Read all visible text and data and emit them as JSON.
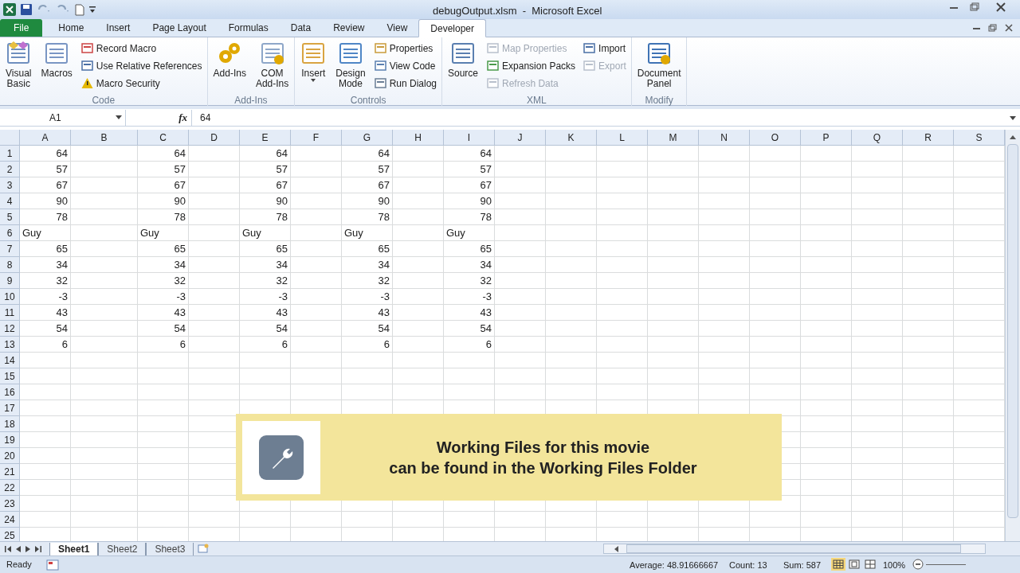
{
  "window": {
    "title": "debugOutput.xlsm  -  Microsoft Excel"
  },
  "tabs": [
    {
      "label": "File",
      "kind": "file",
      "selected": false
    },
    {
      "label": "Home",
      "kind": "tab",
      "selected": false
    },
    {
      "label": "Insert",
      "kind": "tab",
      "selected": false
    },
    {
      "label": "Page Layout",
      "kind": "tab",
      "selected": false
    },
    {
      "label": "Formulas",
      "kind": "tab",
      "selected": false
    },
    {
      "label": "Data",
      "kind": "tab",
      "selected": false
    },
    {
      "label": "Review",
      "kind": "tab",
      "selected": false
    },
    {
      "label": "View",
      "kind": "tab",
      "selected": false
    },
    {
      "label": "Developer",
      "kind": "tab",
      "selected": true
    }
  ],
  "ribbon_groups": [
    {
      "label": "Code",
      "items": [
        {
          "kind": "large",
          "label": "Visual\nBasic",
          "disabled": false
        },
        {
          "kind": "large",
          "label": "Macros",
          "disabled": false
        },
        {
          "kind": "small",
          "label": "Record Macro",
          "disabled": false
        },
        {
          "kind": "small",
          "label": "Use Relative References",
          "disabled": false
        },
        {
          "kind": "small",
          "label": "Macro Security",
          "disabled": false
        }
      ]
    },
    {
      "label": "Add-Ins",
      "items": [
        {
          "kind": "large",
          "label": "Add-Ins",
          "disabled": false
        },
        {
          "kind": "large",
          "label": "COM\nAdd-Ins",
          "disabled": false
        }
      ]
    },
    {
      "label": "Controls",
      "items": [
        {
          "kind": "large",
          "label": "Insert",
          "dropdown": true,
          "disabled": false
        },
        {
          "kind": "large",
          "label": "Design\nMode",
          "disabled": false
        },
        {
          "kind": "small",
          "label": "Properties",
          "disabled": false
        },
        {
          "kind": "small",
          "label": "View Code",
          "disabled": false
        },
        {
          "kind": "small",
          "label": "Run Dialog",
          "disabled": false
        }
      ]
    },
    {
      "label": "XML",
      "items": [
        {
          "kind": "large",
          "label": "Source",
          "disabled": false
        },
        {
          "kind": "small",
          "label": "Map Properties",
          "disabled": true
        },
        {
          "kind": "small",
          "label": "Expansion Packs",
          "disabled": false
        },
        {
          "kind": "small",
          "label": "Refresh Data",
          "disabled": true
        },
        {
          "kind": "small",
          "label": "Import",
          "disabled": false
        },
        {
          "kind": "small",
          "label": "Export",
          "disabled": true
        }
      ]
    },
    {
      "label": "Modify",
      "items": [
        {
          "kind": "large",
          "label": "Document\nPanel",
          "disabled": false
        }
      ]
    }
  ],
  "formula_bar": {
    "name_box": "A1",
    "fx": "fx",
    "value": "64"
  },
  "columns": [
    "A",
    "B",
    "C",
    "D",
    "E",
    "F",
    "G",
    "H",
    "I",
    "J",
    "K",
    "L",
    "M",
    "N",
    "O",
    "P",
    "Q",
    "R",
    "S"
  ],
  "rows": [
    {
      "number": "1",
      "cells": [
        {
          "value": "64",
          "kind": "number"
        },
        null,
        {
          "value": "64",
          "kind": "number"
        },
        null,
        {
          "value": "64",
          "kind": "number"
        },
        null,
        {
          "value": "64",
          "kind": "number"
        },
        null,
        {
          "value": "64",
          "kind": "number"
        }
      ]
    },
    {
      "number": "2",
      "cells": [
        {
          "value": "57",
          "kind": "number"
        },
        null,
        {
          "value": "57",
          "kind": "number"
        },
        null,
        {
          "value": "57",
          "kind": "number"
        },
        null,
        {
          "value": "57",
          "kind": "number"
        },
        null,
        {
          "value": "57",
          "kind": "number"
        }
      ]
    },
    {
      "number": "3",
      "cells": [
        {
          "value": "67",
          "kind": "number"
        },
        null,
        {
          "value": "67",
          "kind": "number"
        },
        null,
        {
          "value": "67",
          "kind": "number"
        },
        null,
        {
          "value": "67",
          "kind": "number"
        },
        null,
        {
          "value": "67",
          "kind": "number"
        }
      ]
    },
    {
      "number": "4",
      "cells": [
        {
          "value": "90",
          "kind": "number"
        },
        null,
        {
          "value": "90",
          "kind": "number"
        },
        null,
        {
          "value": "90",
          "kind": "number"
        },
        null,
        {
          "value": "90",
          "kind": "number"
        },
        null,
        {
          "value": "90",
          "kind": "number"
        }
      ]
    },
    {
      "number": "5",
      "cells": [
        {
          "value": "78",
          "kind": "number"
        },
        null,
        {
          "value": "78",
          "kind": "number"
        },
        null,
        {
          "value": "78",
          "kind": "number"
        },
        null,
        {
          "value": "78",
          "kind": "number"
        },
        null,
        {
          "value": "78",
          "kind": "number"
        }
      ]
    },
    {
      "number": "6",
      "cells": [
        {
          "value": "Guy",
          "kind": "text"
        },
        null,
        {
          "value": "Guy",
          "kind": "text"
        },
        null,
        {
          "value": "Guy",
          "kind": "text"
        },
        null,
        {
          "value": "Guy",
          "kind": "text"
        },
        null,
        {
          "value": "Guy",
          "kind": "text"
        }
      ]
    },
    {
      "number": "7",
      "cells": [
        {
          "value": "65",
          "kind": "number"
        },
        null,
        {
          "value": "65",
          "kind": "number"
        },
        null,
        {
          "value": "65",
          "kind": "number"
        },
        null,
        {
          "value": "65",
          "kind": "number"
        },
        null,
        {
          "value": "65",
          "kind": "number"
        }
      ]
    },
    {
      "number": "8",
      "cells": [
        {
          "value": "34",
          "kind": "number"
        },
        null,
        {
          "value": "34",
          "kind": "number"
        },
        null,
        {
          "value": "34",
          "kind": "number"
        },
        null,
        {
          "value": "34",
          "kind": "number"
        },
        null,
        {
          "value": "34",
          "kind": "number"
        }
      ]
    },
    {
      "number": "9",
      "cells": [
        {
          "value": "32",
          "kind": "number"
        },
        null,
        {
          "value": "32",
          "kind": "number"
        },
        null,
        {
          "value": "32",
          "kind": "number"
        },
        null,
        {
          "value": "32",
          "kind": "number"
        },
        null,
        {
          "value": "32",
          "kind": "number"
        }
      ]
    },
    {
      "number": "10",
      "cells": [
        {
          "value": "-3",
          "kind": "number"
        },
        null,
        {
          "value": "-3",
          "kind": "number"
        },
        null,
        {
          "value": "-3",
          "kind": "number"
        },
        null,
        {
          "value": "-3",
          "kind": "number"
        },
        null,
        {
          "value": "-3",
          "kind": "number"
        }
      ]
    },
    {
      "number": "11",
      "cells": [
        {
          "value": "43",
          "kind": "number"
        },
        null,
        {
          "value": "43",
          "kind": "number"
        },
        null,
        {
          "value": "43",
          "kind": "number"
        },
        null,
        {
          "value": "43",
          "kind": "number"
        },
        null,
        {
          "value": "43",
          "kind": "number"
        }
      ]
    },
    {
      "number": "12",
      "cells": [
        {
          "value": "54",
          "kind": "number"
        },
        null,
        {
          "value": "54",
          "kind": "number"
        },
        null,
        {
          "value": "54",
          "kind": "number"
        },
        null,
        {
          "value": "54",
          "kind": "number"
        },
        null,
        {
          "value": "54",
          "kind": "number"
        }
      ]
    },
    {
      "number": "13",
      "cells": [
        {
          "value": "6",
          "kind": "number"
        },
        null,
        {
          "value": "6",
          "kind": "number"
        },
        null,
        {
          "value": "6",
          "kind": "number"
        },
        null,
        {
          "value": "6",
          "kind": "number"
        },
        null,
        {
          "value": "6",
          "kind": "number"
        }
      ]
    },
    {
      "number": "14"
    },
    {
      "number": "15"
    },
    {
      "number": "16"
    },
    {
      "number": "17"
    },
    {
      "number": "18"
    },
    {
      "number": "19"
    },
    {
      "number": "20"
    },
    {
      "number": "21"
    },
    {
      "number": "22"
    },
    {
      "number": "23"
    },
    {
      "number": "24"
    },
    {
      "number": "25"
    }
  ],
  "notice": {
    "lines": [
      "Working Files for this movie",
      "can be found in the Working Files Folder"
    ]
  },
  "sheet_tabs": [
    {
      "label": "Sheet1",
      "selected": true
    },
    {
      "label": "Sheet2",
      "selected": false
    },
    {
      "label": "Sheet3",
      "selected": false
    }
  ],
  "status_bar": {
    "mode": "Ready",
    "average": "Average: 48.91666667",
    "count": "Count: 13",
    "sum": "Sum: 587",
    "zoom": "100%"
  }
}
